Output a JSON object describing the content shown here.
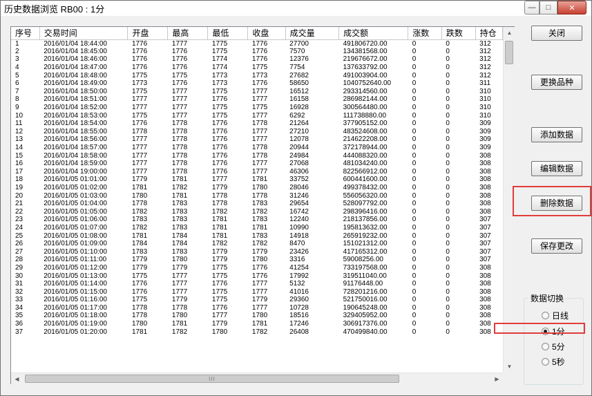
{
  "window": {
    "title": "历史数据浏览 RB00 : 1分",
    "min_glyph": "—",
    "max_glyph": "□",
    "close_glyph": "✕"
  },
  "grid": {
    "columns": [
      "序号",
      "交易时间",
      "开盘",
      "最高",
      "最低",
      "收盘",
      "成交量",
      "成交额",
      "涨数",
      "跌数",
      "持仓"
    ],
    "rows": [
      [
        "1",
        "2016/01/04 18:44:00",
        "1776",
        "1777",
        "1775",
        "1776",
        "27700",
        "491806720.00",
        "0",
        "0",
        "312"
      ],
      [
        "2",
        "2016/01/04 18:45:00",
        "1776",
        "1776",
        "1775",
        "1776",
        "7570",
        "134381568.00",
        "0",
        "0",
        "312"
      ],
      [
        "3",
        "2016/01/04 18:46:00",
        "1776",
        "1776",
        "1774",
        "1776",
        "12376",
        "219676672.00",
        "0",
        "0",
        "312"
      ],
      [
        "4",
        "2016/01/04 18:47:00",
        "1776",
        "1776",
        "1774",
        "1775",
        "7754",
        "137633792.00",
        "0",
        "0",
        "312"
      ],
      [
        "5",
        "2016/01/04 18:48:00",
        "1775",
        "1775",
        "1773",
        "1773",
        "27682",
        "491003904.00",
        "0",
        "0",
        "312"
      ],
      [
        "6",
        "2016/01/04 18:49:00",
        "1773",
        "1776",
        "1773",
        "1776",
        "58650",
        "1040752640.00",
        "0",
        "0",
        "311"
      ],
      [
        "7",
        "2016/01/04 18:50:00",
        "1775",
        "1777",
        "1775",
        "1777",
        "16512",
        "293314560.00",
        "0",
        "0",
        "310"
      ],
      [
        "8",
        "2016/01/04 18:51:00",
        "1777",
        "1777",
        "1776",
        "1777",
        "16158",
        "286982144.00",
        "0",
        "0",
        "310"
      ],
      [
        "9",
        "2016/01/04 18:52:00",
        "1777",
        "1777",
        "1775",
        "1775",
        "16928",
        "300564480.00",
        "0",
        "0",
        "310"
      ],
      [
        "10",
        "2016/01/04 18:53:00",
        "1775",
        "1777",
        "1775",
        "1777",
        "6292",
        "111738880.00",
        "0",
        "0",
        "310"
      ],
      [
        "11",
        "2016/01/04 18:54:00",
        "1776",
        "1778",
        "1776",
        "1778",
        "21264",
        "377905152.00",
        "0",
        "0",
        "309"
      ],
      [
        "12",
        "2016/01/04 18:55:00",
        "1778",
        "1778",
        "1776",
        "1777",
        "27210",
        "483524608.00",
        "0",
        "0",
        "309"
      ],
      [
        "13",
        "2016/01/04 18:56:00",
        "1777",
        "1778",
        "1776",
        "1777",
        "12078",
        "214622208.00",
        "0",
        "0",
        "309"
      ],
      [
        "14",
        "2016/01/04 18:57:00",
        "1777",
        "1778",
        "1776",
        "1778",
        "20944",
        "372178944.00",
        "0",
        "0",
        "309"
      ],
      [
        "15",
        "2016/01/04 18:58:00",
        "1777",
        "1778",
        "1776",
        "1778",
        "24984",
        "444088320.00",
        "0",
        "0",
        "308"
      ],
      [
        "16",
        "2016/01/04 18:59:00",
        "1777",
        "1778",
        "1776",
        "1777",
        "27068",
        "481034240.00",
        "0",
        "0",
        "308"
      ],
      [
        "17",
        "2016/01/04 19:00:00",
        "1777",
        "1778",
        "1776",
        "1777",
        "46306",
        "822566912.00",
        "0",
        "0",
        "308"
      ],
      [
        "18",
        "2016/01/05 01:01:00",
        "1779",
        "1781",
        "1777",
        "1781",
        "33752",
        "600441600.00",
        "0",
        "0",
        "308"
      ],
      [
        "19",
        "2016/01/05 01:02:00",
        "1781",
        "1782",
        "1779",
        "1780",
        "28046",
        "499378432.00",
        "0",
        "0",
        "308"
      ],
      [
        "20",
        "2016/01/05 01:03:00",
        "1780",
        "1781",
        "1778",
        "1778",
        "31246",
        "556056320.00",
        "0",
        "0",
        "308"
      ],
      [
        "21",
        "2016/01/05 01:04:00",
        "1778",
        "1783",
        "1778",
        "1783",
        "29654",
        "528097792.00",
        "0",
        "0",
        "308"
      ],
      [
        "22",
        "2016/01/05 01:05:00",
        "1782",
        "1783",
        "1782",
        "1782",
        "16742",
        "298396416.00",
        "0",
        "0",
        "308"
      ],
      [
        "23",
        "2016/01/05 01:06:00",
        "1783",
        "1783",
        "1781",
        "1783",
        "12240",
        "218137856.00",
        "0",
        "0",
        "307"
      ],
      [
        "24",
        "2016/01/05 01:07:00",
        "1782",
        "1783",
        "1781",
        "1781",
        "10990",
        "195813632.00",
        "0",
        "0",
        "307"
      ],
      [
        "25",
        "2016/01/05 01:08:00",
        "1781",
        "1784",
        "1781",
        "1783",
        "14918",
        "265919232.00",
        "0",
        "0",
        "307"
      ],
      [
        "26",
        "2016/01/05 01:09:00",
        "1784",
        "1784",
        "1782",
        "1782",
        "8470",
        "151021312.00",
        "0",
        "0",
        "307"
      ],
      [
        "27",
        "2016/01/05 01:10:00",
        "1783",
        "1783",
        "1779",
        "1779",
        "23426",
        "417165312.00",
        "0",
        "0",
        "307"
      ],
      [
        "28",
        "2016/01/05 01:11:00",
        "1779",
        "1780",
        "1779",
        "1780",
        "3316",
        "59008256.00",
        "0",
        "0",
        "307"
      ],
      [
        "29",
        "2016/01/05 01:12:00",
        "1779",
        "1779",
        "1775",
        "1776",
        "41254",
        "733197568.00",
        "0",
        "0",
        "308"
      ],
      [
        "30",
        "2016/01/05 01:13:00",
        "1775",
        "1777",
        "1775",
        "1776",
        "17992",
        "319511040.00",
        "0",
        "0",
        "308"
      ],
      [
        "31",
        "2016/01/05 01:14:00",
        "1776",
        "1777",
        "1776",
        "1777",
        "5132",
        "91176448.00",
        "0",
        "0",
        "308"
      ],
      [
        "32",
        "2016/01/05 01:15:00",
        "1776",
        "1777",
        "1775",
        "1777",
        "41016",
        "728201216.00",
        "0",
        "0",
        "308"
      ],
      [
        "33",
        "2016/01/05 01:16:00",
        "1775",
        "1779",
        "1775",
        "1779",
        "29360",
        "521750016.00",
        "0",
        "0",
        "308"
      ],
      [
        "34",
        "2016/01/05 01:17:00",
        "1778",
        "1778",
        "1776",
        "1777",
        "10728",
        "190645248.00",
        "0",
        "0",
        "308"
      ],
      [
        "35",
        "2016/01/05 01:18:00",
        "1778",
        "1780",
        "1777",
        "1780",
        "18516",
        "329405952.00",
        "0",
        "0",
        "308"
      ],
      [
        "36",
        "2016/01/05 01:19:00",
        "1780",
        "1781",
        "1779",
        "1781",
        "17246",
        "306917376.00",
        "0",
        "0",
        "308"
      ],
      [
        "37",
        "2016/01/05 01:20:00",
        "1781",
        "1782",
        "1780",
        "1782",
        "26408",
        "470499840.00",
        "0",
        "0",
        "308"
      ]
    ],
    "hscroll_grip": "III"
  },
  "buttons": {
    "close": "关闭",
    "change_symbol": "更换品种",
    "add_data": "添加数据",
    "edit_data": "编辑数据",
    "delete_data": "删除数据",
    "save_changes": "保存更改"
  },
  "data_switch": {
    "label": "数据切换",
    "options": [
      "日线",
      "1分",
      "5分",
      "5秒"
    ],
    "selected": "1分"
  },
  "colors": {
    "highlight": "#e23b3b"
  }
}
